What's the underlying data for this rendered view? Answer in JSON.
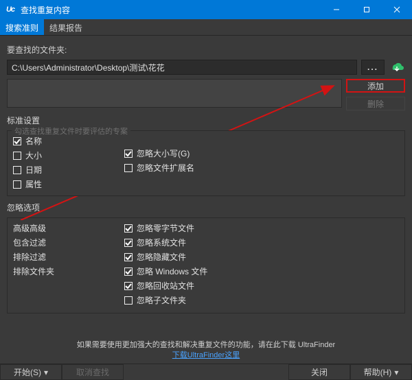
{
  "window": {
    "title": "查找重复内容",
    "logo": "Uc"
  },
  "tabs": [
    "搜索准则",
    "结果报告"
  ],
  "path": {
    "label": "要查找的文件夹:",
    "value": "C:\\Users\\Administrator\\Desktop\\测试\\花花",
    "browseIcon": "..."
  },
  "sideButtons": {
    "add": "添加",
    "remove": "删除"
  },
  "standard": {
    "section": "标准设置",
    "groupTitle": "勾选查找重复文件时要评估的专案",
    "criteria": [
      {
        "label": "名称",
        "checked": true
      },
      {
        "label": "大小",
        "checked": false
      },
      {
        "label": "日期",
        "checked": false
      },
      {
        "label": "属性",
        "checked": false
      }
    ],
    "right": [
      {
        "label": "忽略大小写(G)",
        "checked": true
      },
      {
        "label": "忽略文件扩展名",
        "checked": false
      }
    ]
  },
  "skip": {
    "section": "忽略选项",
    "left": [
      "高级高级",
      "包含过滤",
      "排除过滤",
      "排除文件夹"
    ],
    "right": [
      {
        "label": "忽略零字节文件",
        "checked": true
      },
      {
        "label": "忽略系统文件",
        "checked": true
      },
      {
        "label": "忽略隐藏文件",
        "checked": true
      },
      {
        "label": "忽略 Windows 文件",
        "checked": true
      },
      {
        "label": "忽略回收站文件",
        "checked": true
      },
      {
        "label": "忽略子文件夹",
        "checked": false
      }
    ]
  },
  "promo": {
    "line1": "如果需要使用更加强大的查找和解决重复文件的功能，请在此下载 UltraFinder",
    "linkText": "下载UltraFinder这里"
  },
  "footer": {
    "start": "开始(S)",
    "cancel": "取消查找",
    "close": "关闭",
    "help": "帮助(H)"
  }
}
